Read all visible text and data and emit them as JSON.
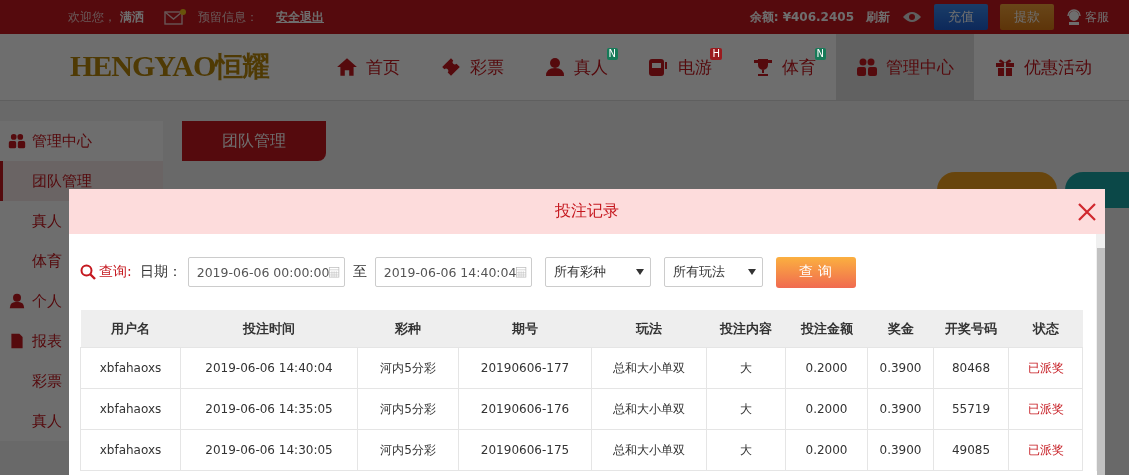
{
  "top_bar": {
    "welcome": "欢迎您，",
    "username": "满洒",
    "reserved_label": "预留信息：",
    "logout": "安全退出",
    "balance": "余额: ¥406.2405",
    "refresh": "刷新",
    "buttons": [
      {
        "label": "充值",
        "kind": "deposit"
      },
      {
        "label": "提款",
        "kind": "withdraw"
      }
    ],
    "service": "客服"
  },
  "logo": {
    "latin": "HENGYAO",
    "chinese": "恒耀"
  },
  "nav": [
    {
      "label": "首页",
      "selected": false
    },
    {
      "label": "彩票",
      "selected": false
    },
    {
      "label": "真人",
      "badge": "N",
      "color": "#167a58",
      "selected": false
    },
    {
      "label": "电游",
      "badge": "H",
      "color": "#9a1a1e",
      "selected": false
    },
    {
      "label": "体育",
      "badge": "N",
      "color": "#167a58",
      "selected": false
    },
    {
      "label": "管理中心",
      "selected": true
    },
    {
      "label": "优惠活动",
      "selected": false
    }
  ],
  "sidebar": [
    {
      "kind": "header",
      "label": "管理中心",
      "selected": false
    },
    {
      "kind": "item",
      "label": "团队管理",
      "selected": true
    },
    {
      "kind": "item",
      "label": "真人",
      "selected": false
    },
    {
      "kind": "item",
      "label": "体育",
      "selected": false
    },
    {
      "kind": "header",
      "label": "个人",
      "selected": false
    },
    {
      "kind": "header",
      "label": "报表",
      "selected": false
    },
    {
      "kind": "item",
      "label": "彩票",
      "selected": false
    },
    {
      "kind": "item",
      "label": "真人",
      "selected": false
    }
  ],
  "content_tab": "团队管理",
  "modal": {
    "title": "投注记录",
    "query_label": "查询:",
    "date_label": "日期：",
    "date_from": "2019-06-06 00:00:00",
    "to_label": "至",
    "date_to": "2019-06-06 14:40:04",
    "lottery_select": "所有彩种",
    "play_select": "所有玩法",
    "search_button": "查 询",
    "columns": [
      "用户名",
      "投注时间",
      "彩种",
      "期号",
      "玩法",
      "投注内容",
      "投注金额",
      "奖金",
      "开奖号码",
      "状态"
    ],
    "rows": [
      [
        "xbfahaoxs",
        "2019-06-06 14:40:04",
        "河内5分彩",
        "20190606-177",
        "总和大小单双",
        "大",
        "0.2000",
        "0.3900",
        "80468",
        "已派奖"
      ],
      [
        "xbfahaoxs",
        "2019-06-06 14:35:05",
        "河内5分彩",
        "20190606-176",
        "总和大小单双",
        "大",
        "0.2000",
        "0.3900",
        "55719",
        "已派奖"
      ],
      [
        "xbfahaoxs",
        "2019-06-06 14:30:05",
        "河内5分彩",
        "20190606-175",
        "总和大小单双",
        "大",
        "0.2000",
        "0.3900",
        "49085",
        "已派奖"
      ]
    ]
  }
}
